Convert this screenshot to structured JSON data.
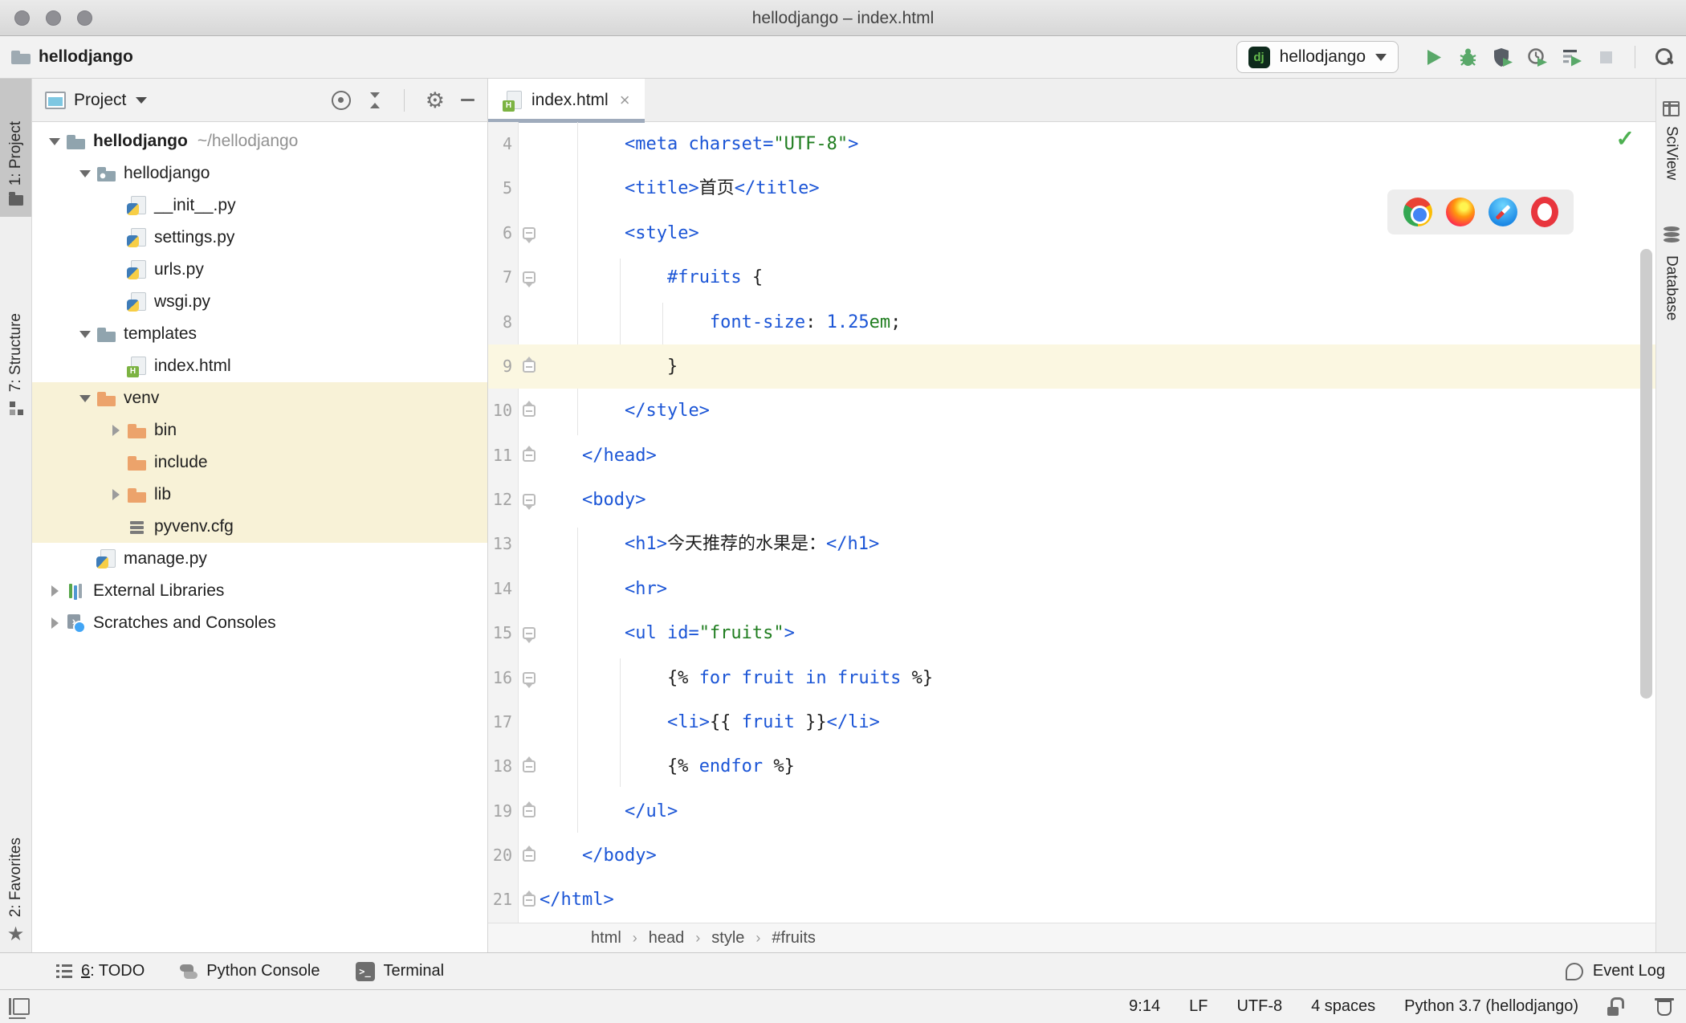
{
  "window": {
    "title": "hellodjango – index.html"
  },
  "toolbar": {
    "project": "hellodjango",
    "run_config": {
      "badge": "dj",
      "name": "hellodjango"
    },
    "action_icons": [
      "run-icon",
      "debug-icon",
      "run-with-coverage-icon",
      "profiler-icon",
      "execute-icon",
      "stop-icon",
      "search-everywhere-icon"
    ]
  },
  "left_toolbar": {
    "items": [
      {
        "label": "1: Project",
        "icon": "project-folder-icon",
        "active": true
      },
      {
        "label": "7: Structure",
        "icon": "structure-icon",
        "active": false
      },
      {
        "label": "2: Favorites",
        "icon": "star-icon",
        "active": false
      }
    ]
  },
  "right_toolbar": {
    "items": [
      {
        "label": "SciView",
        "icon": "grid-table-icon"
      },
      {
        "label": "Database",
        "icon": "database-icon"
      }
    ]
  },
  "project_panel": {
    "header": {
      "title": "Project",
      "icons": [
        "locate-icon",
        "collapse-all-icon",
        "settings-gear-icon",
        "hide-icon"
      ]
    },
    "tree": [
      {
        "label": "hellodjango",
        "hint": "~/hellodjango",
        "icon": "folder",
        "indent": 0,
        "expander": "open",
        "bold": true
      },
      {
        "label": "hellodjango",
        "icon": "package",
        "indent": 1,
        "expander": "open"
      },
      {
        "label": "__init__.py",
        "icon": "python",
        "indent": 2
      },
      {
        "label": "settings.py",
        "icon": "python",
        "indent": 2
      },
      {
        "label": "urls.py",
        "icon": "python",
        "indent": 2
      },
      {
        "label": "wsgi.py",
        "icon": "python",
        "indent": 2
      },
      {
        "label": "templates",
        "icon": "folder",
        "indent": 1,
        "expander": "open"
      },
      {
        "label": "index.html",
        "icon": "html",
        "indent": 2
      },
      {
        "label": "venv",
        "icon": "folder-orange",
        "indent": 1,
        "expander": "open",
        "highlighted": true
      },
      {
        "label": "bin",
        "icon": "folder-orange",
        "indent": 2,
        "expander": "closed",
        "highlighted": true
      },
      {
        "label": "include",
        "icon": "folder-orange",
        "indent": 2,
        "highlighted": true
      },
      {
        "label": "lib",
        "icon": "folder-orange",
        "indent": 2,
        "expander": "closed",
        "highlighted": true
      },
      {
        "label": "pyvenv.cfg",
        "icon": "config-lines",
        "indent": 2,
        "highlighted": true
      },
      {
        "label": "manage.py",
        "icon": "python",
        "indent": 1
      },
      {
        "label": "External Libraries",
        "icon": "libraries",
        "indent": 0,
        "expander": "closed"
      },
      {
        "label": "Scratches and Consoles",
        "icon": "scratches",
        "indent": 0,
        "expander": "closed"
      }
    ]
  },
  "editor": {
    "tabs": [
      {
        "label": "index.html",
        "icon": "html-file-icon",
        "active": true,
        "closable": true
      }
    ],
    "inspection_status": "no-problems-check",
    "browser_preview_icons": [
      "chrome",
      "firefox",
      "safari",
      "opera"
    ],
    "breadcrumbs": [
      "html",
      "head",
      "style",
      "#fruits"
    ],
    "lines": [
      {
        "n": "4",
        "fold": "",
        "hl": false,
        "tokens": [
          [
            "t",
            "        "
          ],
          [
            "b",
            "<meta charset="
          ],
          [
            "g",
            "\"UTF-8\""
          ],
          [
            "b",
            ">"
          ]
        ]
      },
      {
        "n": "5",
        "fold": "",
        "hl": false,
        "tokens": [
          [
            "t",
            "        "
          ],
          [
            "b",
            "<title>"
          ],
          [
            "t",
            "首页"
          ],
          [
            "b",
            "</title>"
          ]
        ]
      },
      {
        "n": "6",
        "fold": "open",
        "hl": false,
        "tokens": [
          [
            "t",
            "        "
          ],
          [
            "b",
            "<style>"
          ]
        ]
      },
      {
        "n": "7",
        "fold": "open",
        "hl": false,
        "tokens": [
          [
            "t",
            "            "
          ],
          [
            "b",
            "#fruits"
          ],
          [
            "t",
            " {"
          ]
        ]
      },
      {
        "n": "8",
        "fold": "",
        "hl": false,
        "tokens": [
          [
            "t",
            "                "
          ],
          [
            "b",
            "font-size"
          ],
          [
            "t",
            ": "
          ],
          [
            "b",
            "1.25"
          ],
          [
            "g",
            "em"
          ],
          [
            "t",
            ";"
          ]
        ]
      },
      {
        "n": "9",
        "fold": "close",
        "hl": true,
        "tokens": [
          [
            "t",
            "            }"
          ]
        ]
      },
      {
        "n": "10",
        "fold": "close",
        "hl": false,
        "tokens": [
          [
            "t",
            "        "
          ],
          [
            "b",
            "</style>"
          ]
        ]
      },
      {
        "n": "11",
        "fold": "close",
        "hl": false,
        "tokens": [
          [
            "t",
            "    "
          ],
          [
            "b",
            "</head>"
          ]
        ]
      },
      {
        "n": "12",
        "fold": "open",
        "hl": false,
        "tokens": [
          [
            "t",
            "    "
          ],
          [
            "b",
            "<body>"
          ]
        ]
      },
      {
        "n": "13",
        "fold": "",
        "hl": false,
        "tokens": [
          [
            "t",
            "        "
          ],
          [
            "b",
            "<h1>"
          ],
          [
            "t",
            "今天推荐的水果是："
          ],
          [
            "b",
            "</h1>"
          ]
        ]
      },
      {
        "n": "14",
        "fold": "",
        "hl": false,
        "tokens": [
          [
            "t",
            "        "
          ],
          [
            "b",
            "<hr>"
          ]
        ]
      },
      {
        "n": "15",
        "fold": "open",
        "hl": false,
        "tokens": [
          [
            "t",
            "        "
          ],
          [
            "b",
            "<ul id="
          ],
          [
            "g",
            "\"fruits\""
          ],
          [
            "b",
            ">"
          ]
        ]
      },
      {
        "n": "16",
        "fold": "open",
        "hl": false,
        "tokens": [
          [
            "t",
            "            {% "
          ],
          [
            "b",
            "for fruit in fruits"
          ],
          [
            "t",
            " %}"
          ]
        ]
      },
      {
        "n": "17",
        "fold": "",
        "hl": false,
        "tokens": [
          [
            "t",
            "            "
          ],
          [
            "b",
            "<li>"
          ],
          [
            "t",
            "{{ "
          ],
          [
            "b",
            "fruit"
          ],
          [
            "t",
            " }}"
          ],
          [
            "b",
            "</li>"
          ]
        ]
      },
      {
        "n": "18",
        "fold": "close",
        "hl": false,
        "tokens": [
          [
            "t",
            "            {% "
          ],
          [
            "b",
            "endfor"
          ],
          [
            "t",
            " %}"
          ]
        ]
      },
      {
        "n": "19",
        "fold": "close",
        "hl": false,
        "tokens": [
          [
            "t",
            "        "
          ],
          [
            "b",
            "</ul>"
          ]
        ]
      },
      {
        "n": "20",
        "fold": "close",
        "hl": false,
        "tokens": [
          [
            "t",
            "    "
          ],
          [
            "b",
            "</body>"
          ]
        ]
      },
      {
        "n": "21",
        "fold": "close",
        "hl": false,
        "tokens": [
          [
            "b",
            "</html>"
          ]
        ]
      }
    ]
  },
  "bottom_bar": {
    "tool_buttons": [
      {
        "mnemonic": "6",
        "label": ": TODO",
        "icon": "todo-list-icon"
      },
      {
        "mnemonic": "",
        "label": "Python Console",
        "icon": "python-console-icon"
      },
      {
        "mnemonic": "",
        "label": "Terminal",
        "icon": "terminal-icon"
      }
    ],
    "event_log": {
      "label": "Event Log",
      "icon": "event-log-icon"
    }
  },
  "status_bar": {
    "caret": "9:14",
    "line_ending": "LF",
    "encoding": "UTF-8",
    "indent": "4 spaces",
    "interpreter": "Python 3.7 (hellodjango)",
    "icons": [
      "unlock-icon",
      "inspections-profile-icon"
    ]
  },
  "colors": {
    "syntax_blue": "#1b55d6",
    "syntax_green": "#1f7d1f",
    "text": "#1f1f1f",
    "caret_line": "#fbf7e1",
    "excluded_highlight": "#f8f2d7",
    "run_green": "#59a869",
    "tab_underline": "#9fabbc",
    "check_green": "#4db051"
  }
}
